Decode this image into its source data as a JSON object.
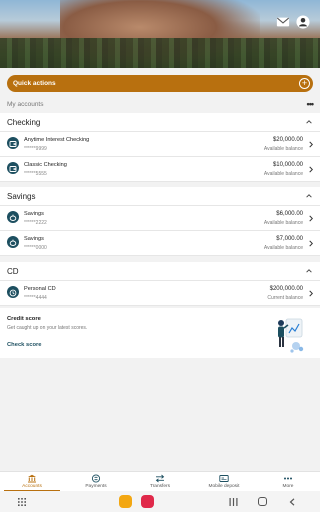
{
  "header": {
    "icons": [
      "mail-icon",
      "user-icon"
    ]
  },
  "quick_actions": {
    "label": "Quick actions",
    "icon": "plus-circle-icon"
  },
  "my_accounts": {
    "label": "My accounts",
    "more": "•••"
  },
  "sections": [
    {
      "title": "Checking",
      "accounts": [
        {
          "name": "Anytime Interest Checking",
          "number": "******9999",
          "amount": "$20,000.00",
          "balance_label": "Available balance",
          "icon": "wallet-icon"
        },
        {
          "name": "Classic Checking",
          "number": "******5555",
          "amount": "$10,000.00",
          "balance_label": "Available balance",
          "icon": "wallet-icon"
        }
      ]
    },
    {
      "title": "Savings",
      "accounts": [
        {
          "name": "Savings",
          "number": "******2222",
          "amount": "$6,000.00",
          "balance_label": "Available balance",
          "icon": "piggy-bank-icon"
        },
        {
          "name": "Savings",
          "number": "******0000",
          "amount": "$7,000.00",
          "balance_label": "Available balance",
          "icon": "piggy-bank-icon"
        }
      ]
    },
    {
      "title": "CD",
      "accounts": [
        {
          "name": "Personal CD",
          "number": "******4444",
          "amount": "$200,000.00",
          "balance_label": "Current balance",
          "icon": "clock-icon"
        }
      ]
    }
  ],
  "credit_score": {
    "title": "Credit score",
    "subtitle": "Get caught up on your latest scores.",
    "link": "Check score"
  },
  "tabs": [
    {
      "label": "Accounts",
      "icon": "bank-icon",
      "active": true
    },
    {
      "label": "Payments",
      "icon": "payments-icon",
      "active": false
    },
    {
      "label": "Transfers",
      "icon": "transfer-icon",
      "active": false
    },
    {
      "label": "Mobile deposit",
      "icon": "check-deposit-icon",
      "active": false
    },
    {
      "label": "More",
      "icon": "more-dots-icon",
      "active": false
    }
  ],
  "colors": {
    "accent": "#b8700f",
    "primary": "#1d4f60"
  }
}
